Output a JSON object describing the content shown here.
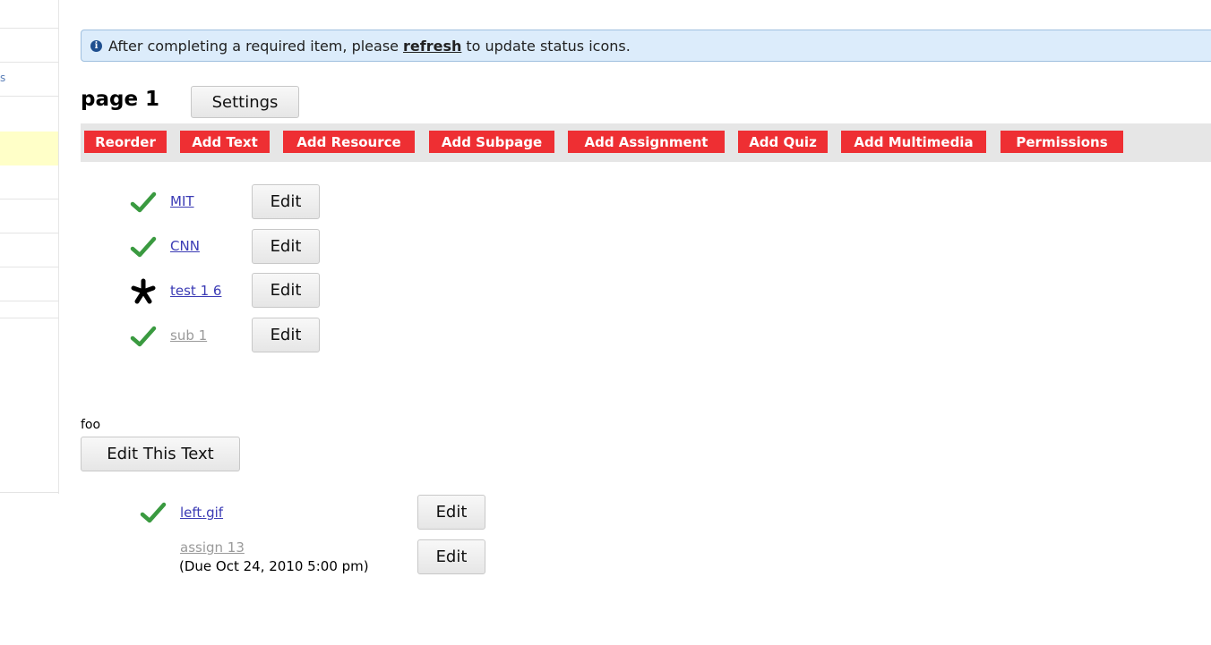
{
  "sidebar": {
    "fragment": "s"
  },
  "banner": {
    "text_before": "After completing a required item, please",
    "link": "refresh",
    "text_after": "to update status icons."
  },
  "page": {
    "title": "page 1",
    "settings_label": "Settings"
  },
  "toolbar": [
    "Reorder",
    "Add Text",
    "Add Resource",
    "Add Subpage",
    "Add Assignment",
    "Add Quiz",
    "Add Multimedia",
    "Permissions"
  ],
  "items": [
    {
      "label": "MIT",
      "status": "check-icon",
      "edit": "Edit"
    },
    {
      "label": "CNN",
      "status": "check-icon",
      "edit": "Edit"
    },
    {
      "label": "test 1 6",
      "status": "asterisk-icon",
      "edit": "Edit"
    },
    {
      "label": "sub 1",
      "status": "check-icon",
      "edit": "Edit",
      "dimmed": true
    }
  ],
  "text_block": {
    "text": "foo",
    "edit_label": "Edit This Text"
  },
  "items2": [
    {
      "label": "left.gif",
      "status": "check-icon",
      "edit": "Edit"
    },
    {
      "label": "assign 13",
      "due": "(Due Oct 24, 2010 5:00 pm)",
      "edit": "Edit",
      "dimmed": true
    }
  ],
  "colors": {
    "toolbar_button": "#ee2f33",
    "check": "#3a9a40",
    "banner_bg": "#dcecfb",
    "link": "#3b3bb5"
  }
}
